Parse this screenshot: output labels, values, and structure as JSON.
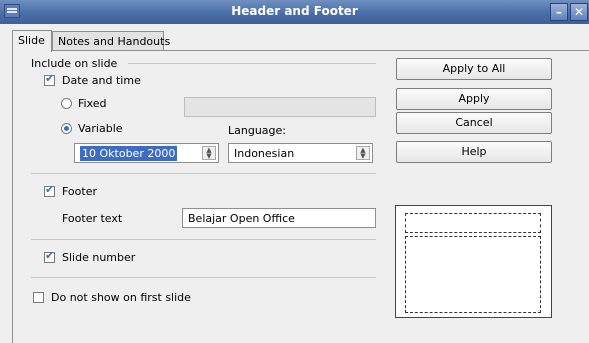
{
  "window": {
    "title": "Header and Footer",
    "minimize_glyph": "–",
    "close_glyph": "✕"
  },
  "tabs": [
    {
      "label": "Slide"
    },
    {
      "label": "Notes and Handouts"
    }
  ],
  "slide": {
    "group_title": "Include on slide",
    "date_and_time": {
      "label": "Date and time",
      "checked": true
    },
    "fixed": {
      "label": "Fixed",
      "selected": false,
      "value": ""
    },
    "variable": {
      "label": "Variable",
      "selected": true,
      "format_value": "10 Oktober 2000"
    },
    "language": {
      "label": "Language:",
      "value": "Indonesian"
    },
    "footer": {
      "label": "Footer",
      "checked": true,
      "text_label": "Footer text",
      "text_value": "Belajar Open Office"
    },
    "slide_number": {
      "label": "Slide number",
      "checked": true
    },
    "not_first": {
      "label": "Do not show on first slide",
      "checked": false
    }
  },
  "buttons": {
    "apply_all": "Apply to All",
    "apply": "Apply",
    "cancel": "Cancel",
    "help": "Help"
  },
  "colors": {
    "titlebar": "#4a6ea8",
    "accent": "#3b6fb6",
    "selection": "#3d6cc0"
  }
}
